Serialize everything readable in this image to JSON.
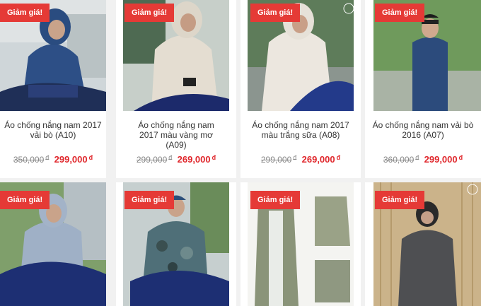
{
  "badge_label": "Giảm giá!",
  "currency": "đ",
  "products": [
    {
      "title": "Áo chống nắng nam 2017 vải bò (A10)",
      "old_price": "350,000",
      "new_price": "299,000"
    },
    {
      "title": "Áo chống nắng nam 2017 màu vàng mơ (A09)",
      "old_price": "299,000",
      "new_price": "269,000"
    },
    {
      "title": "Áo chống nắng nam 2017 màu trắng sữa (A08)",
      "old_price": "299,000",
      "new_price": "269,000"
    },
    {
      "title": "Áo chống nắng nam vải bò 2016 (A07)",
      "old_price": "360,000",
      "new_price": "299,000"
    },
    {
      "title": "",
      "old_price": "",
      "new_price": ""
    },
    {
      "title": "",
      "old_price": "",
      "new_price": ""
    },
    {
      "title": "",
      "old_price": "",
      "new_price": ""
    },
    {
      "title": "",
      "old_price": "",
      "new_price": ""
    }
  ],
  "image_icons": [
    "jacket-photo-denim-rider",
    "jacket-photo-beige-rider",
    "jacket-photo-white-rider",
    "jacket-photo-denim-standing",
    "jacket-photo-grey-rider",
    "jacket-photo-camo-rider",
    "jacket-photo-olive-flatlay",
    "jacket-photo-grey-standing"
  ],
  "colors": {
    "badge": "#e53a36",
    "new_price": "#e0272c",
    "old_price": "#888888"
  }
}
